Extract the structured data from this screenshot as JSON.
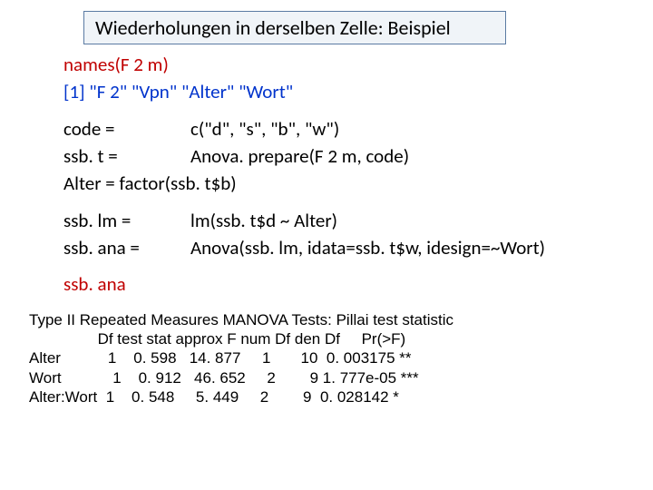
{
  "title": "Wiederholungen in derselben Zelle: Beispiel",
  "code": {
    "names_call": "names(F 2 m)",
    "names_out": "[1] \"F 2\"    \"Vpn\"   \"Alter\" \"Wort\"",
    "code_lhs": "code =",
    "code_rhs": "c(\"d\", \"s\", \"b\", \"w\")",
    "ssbt_lhs": "ssb. t =",
    "ssbt_rhs": "Anova. prepare(F 2 m, code)",
    "alter_line": "Alter = factor(ssb. t$b)",
    "ssblm_lhs": "ssb. lm =",
    "ssblm_rhs": "lm(ssb. t$d ~ Alter)",
    "ssbana_lhs": "ssb. ana =",
    "ssbana_rhs": "Anova(ssb. lm, idata=ssb. t$w, idesign=~Wort)",
    "ssbana_call": "ssb. ana"
  },
  "output": {
    "header": "Type II Repeated Measures MANOVA Tests: Pillai test statistic",
    "colhdr": "                Df test stat approx F num Df den Df     Pr(>F)",
    "row1": "Alter           1    0. 598   14. 877     1       10  0. 003175 **",
    "row2": "Wort            1    0. 912   46. 652     2        9 1. 777e-05 ***",
    "row3": "Alter:Wort  1    0. 548     5. 449     2        9  0. 028142 *"
  }
}
